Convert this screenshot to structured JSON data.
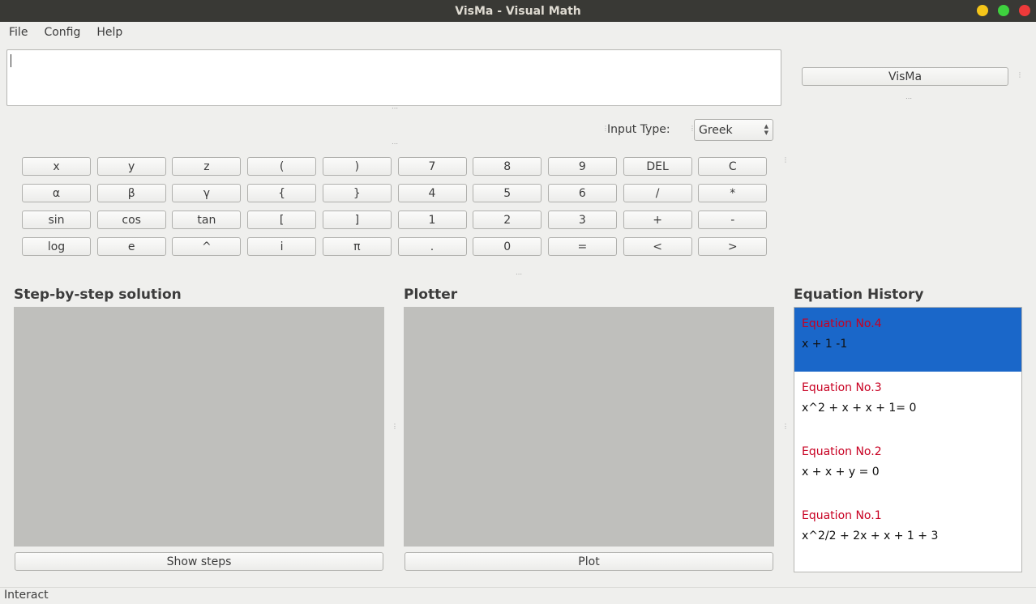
{
  "window": {
    "title": "VisMa - Visual Math"
  },
  "menu": {
    "file": "File",
    "config": "Config",
    "help": "Help"
  },
  "input": {
    "value": ""
  },
  "visma_button": "VisMa",
  "input_type": {
    "label": "Input Type:",
    "selected": "Greek"
  },
  "keypad": {
    "rows": [
      [
        "x",
        "y",
        "z",
        "(",
        ")",
        "7",
        "8",
        "9",
        "DEL",
        "C"
      ],
      [
        "α",
        "β",
        "γ",
        "{",
        "}",
        "4",
        "5",
        "6",
        "/",
        "*"
      ],
      [
        "sin",
        "cos",
        "tan",
        "[",
        "]",
        "1",
        "2",
        "3",
        "+",
        "-"
      ],
      [
        "log",
        "e",
        "^",
        "i",
        "π",
        ".",
        "0",
        "=",
        "<",
        ">"
      ]
    ]
  },
  "steps": {
    "title": "Step-by-step solution",
    "button": "Show steps"
  },
  "plotter": {
    "title": "Plotter",
    "button": "Plot"
  },
  "history": {
    "title": "Equation History",
    "items": [
      {
        "title": "Equation No.4",
        "expr": "x + 1 -1",
        "selected": true
      },
      {
        "title": "Equation No.3",
        "expr": "x^2 + x + x + 1= 0"
      },
      {
        "title": "Equation No.2",
        "expr": "x + x + y = 0"
      },
      {
        "title": "Equation No.1",
        "expr": "x^2/2 + 2x + x + 1 + 3"
      }
    ]
  },
  "status": "Interact",
  "colors": {
    "accent": "#1a67c9",
    "equation_title": "#c80022",
    "titlebar": "#393935"
  }
}
